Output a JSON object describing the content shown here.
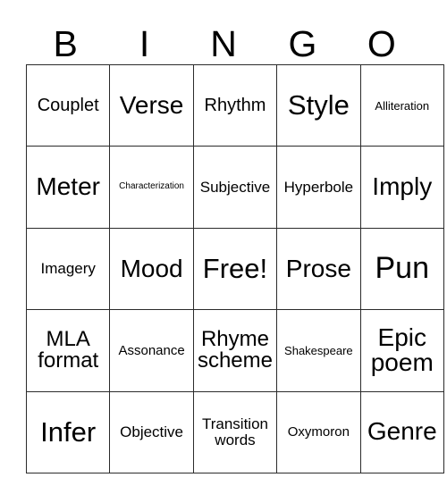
{
  "card": {
    "header_letters": [
      "B",
      "I",
      "N",
      "G",
      "O"
    ],
    "border_color": "#2b2b2b",
    "background_color": "#ffffff",
    "text_color": "#000000",
    "rows": [
      [
        {
          "label": "Couplet",
          "size": "fs-l"
        },
        {
          "label": "Verse",
          "size": "fs-xxl"
        },
        {
          "label": "Rhythm",
          "size": "fs-l"
        },
        {
          "label": "Style",
          "size": "fs-3xl"
        },
        {
          "label": "Alliteration",
          "size": "fs-xs"
        }
      ],
      [
        {
          "label": "Meter",
          "size": "fs-xxl"
        },
        {
          "label": "Characterization",
          "size": "fs-xxs"
        },
        {
          "label": "Subjective",
          "size": "fs-m"
        },
        {
          "label": "Hyperbole",
          "size": "fs-m"
        },
        {
          "label": "Imply",
          "size": "fs-xxl"
        }
      ],
      [
        {
          "label": "Imagery",
          "size": "fs-m"
        },
        {
          "label": "Mood",
          "size": "fs-xxl"
        },
        {
          "label": "Free!",
          "size": "fs-3xl"
        },
        {
          "label": "Prose",
          "size": "fs-xxl"
        },
        {
          "label": "Pun",
          "size": "fs-4xl"
        }
      ],
      [
        {
          "label": "MLA format",
          "size": "fs-xl"
        },
        {
          "label": "Assonance",
          "size": "fs-s"
        },
        {
          "label": "Rhyme scheme",
          "size": "fs-xl"
        },
        {
          "label": "Shakespeare",
          "size": "fs-xs"
        },
        {
          "label": "Epic poem",
          "size": "fs-xxl"
        }
      ],
      [
        {
          "label": "Infer",
          "size": "fs-3xl"
        },
        {
          "label": "Objective",
          "size": "fs-m"
        },
        {
          "label": "Transition words",
          "size": "fs-m"
        },
        {
          "label": "Oxymoron",
          "size": "fs-s"
        },
        {
          "label": "Genre",
          "size": "fs-xxl"
        }
      ]
    ]
  }
}
